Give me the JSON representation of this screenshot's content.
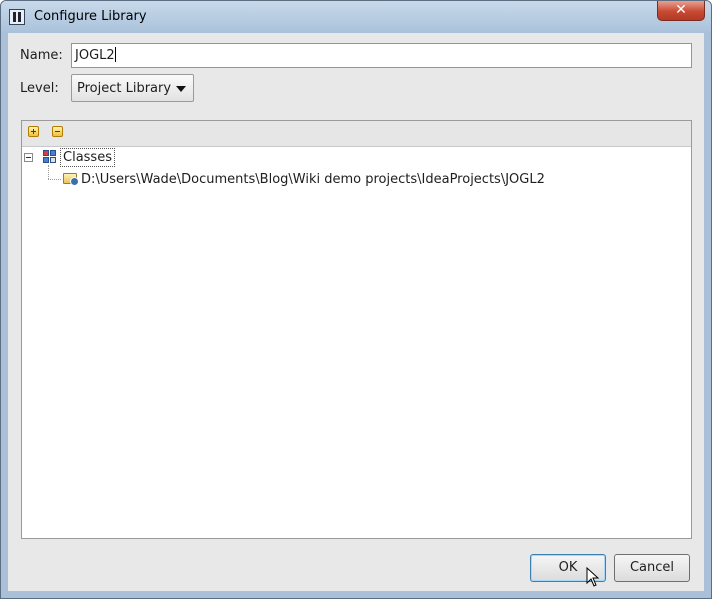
{
  "window": {
    "title": "Configure Library",
    "close_label": "✕"
  },
  "form": {
    "name_label": "Name:",
    "name_value": "JOGL2",
    "level_label": "Level:",
    "level_value": "Project Library"
  },
  "tree": {
    "root_label": "Classes",
    "child_path": "D:\\Users\\Wade\\Documents\\Blog\\Wiki demo projects\\IdeaProjects\\JOGL2"
  },
  "buttons": {
    "ok": "OK",
    "cancel": "Cancel"
  },
  "icons": {
    "app": "intellij-idea-icon",
    "add": "add-icon",
    "remove": "remove-icon",
    "collapse": "tree-collapse-icon",
    "classes": "classes-icon",
    "folder": "jar-folder-icon"
  }
}
